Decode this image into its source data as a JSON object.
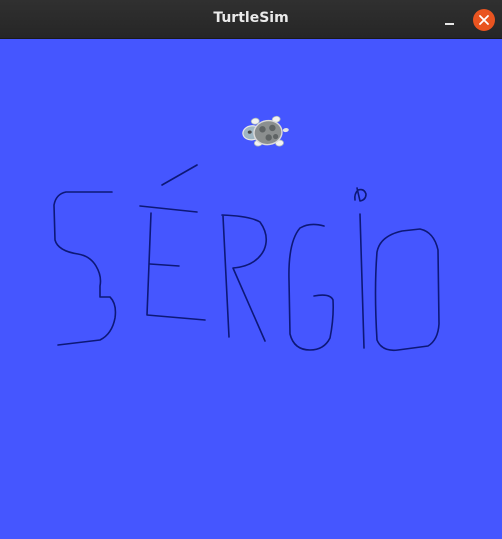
{
  "window": {
    "title": "TurtleSim",
    "background_color": "#4556ff",
    "pen_color": "#0d1877",
    "buttons": {
      "minimize_icon": "minimize-icon",
      "close_icon": "close-icon",
      "close_color": "#e95420"
    }
  },
  "canvas": {
    "drawing_text": "SÉRGIO",
    "turtle_icon": "turtle-icon"
  }
}
